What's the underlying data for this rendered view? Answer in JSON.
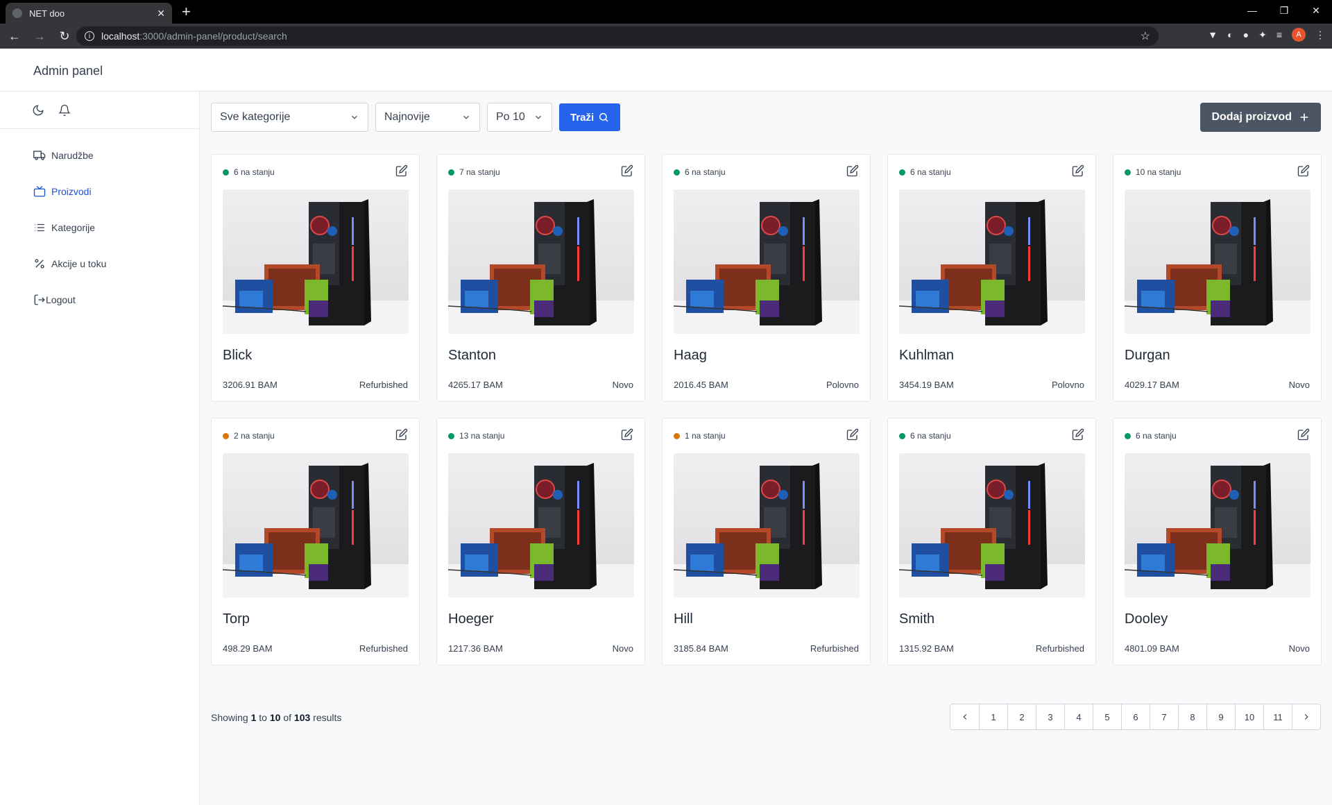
{
  "browser": {
    "tab_title": "NET doo",
    "url_host": "localhost",
    "url_path": ":3000/admin-panel/product/search",
    "profile_initial": "A"
  },
  "app": {
    "brand": "Admin panel"
  },
  "sidebar": {
    "items": [
      {
        "label": "Narudžbe",
        "icon": "truck-icon",
        "active": false
      },
      {
        "label": "Proizvodi",
        "icon": "tv-icon",
        "active": true
      },
      {
        "label": "Kategorije",
        "icon": "list-icon",
        "active": false
      },
      {
        "label": "Akcije u toku",
        "icon": "percent-icon",
        "active": false
      },
      {
        "label": "Logout",
        "icon": "logout-icon",
        "active": false
      }
    ]
  },
  "filters": {
    "category": "Sve kategorije",
    "sort": "Najnovije",
    "per_page": "Po 10",
    "search_label": "Traži"
  },
  "add_button": "Dodaj proizvod",
  "colors": {
    "primary": "#2563eb",
    "in_stock": "#059669",
    "low_stock": "#d97706"
  },
  "products": [
    {
      "stock": "6 na stanju",
      "stock_status": "ok",
      "name": "Blick",
      "price": "3206.91 BAM",
      "condition": "Refurbished"
    },
    {
      "stock": "7 na stanju",
      "stock_status": "ok",
      "name": "Stanton",
      "price": "4265.17 BAM",
      "condition": "Novo"
    },
    {
      "stock": "6 na stanju",
      "stock_status": "ok",
      "name": "Haag",
      "price": "2016.45 BAM",
      "condition": "Polovno"
    },
    {
      "stock": "6 na stanju",
      "stock_status": "ok",
      "name": "Kuhlman",
      "price": "3454.19 BAM",
      "condition": "Polovno"
    },
    {
      "stock": "10 na stanju",
      "stock_status": "ok",
      "name": "Durgan",
      "price": "4029.17 BAM",
      "condition": "Novo"
    },
    {
      "stock": "2 na stanju",
      "stock_status": "low",
      "name": "Torp",
      "price": "498.29 BAM",
      "condition": "Refurbished"
    },
    {
      "stock": "13 na stanju",
      "stock_status": "ok",
      "name": "Hoeger",
      "price": "1217.36 BAM",
      "condition": "Novo"
    },
    {
      "stock": "1 na stanju",
      "stock_status": "low",
      "name": "Hill",
      "price": "3185.84 BAM",
      "condition": "Refurbished"
    },
    {
      "stock": "6 na stanju",
      "stock_status": "ok",
      "name": "Smith",
      "price": "1315.92 BAM",
      "condition": "Refurbished"
    },
    {
      "stock": "6 na stanju",
      "stock_status": "ok",
      "name": "Dooley",
      "price": "4801.09 BAM",
      "condition": "Novo"
    }
  ],
  "results": {
    "prefix": "Showing",
    "from": "1",
    "to_word": "to",
    "to": "10",
    "of_word": "of",
    "total": "103",
    "suffix": "results"
  },
  "pagination": {
    "pages": [
      "1",
      "2",
      "3",
      "4",
      "5",
      "6",
      "7",
      "8",
      "9",
      "10",
      "11"
    ]
  }
}
